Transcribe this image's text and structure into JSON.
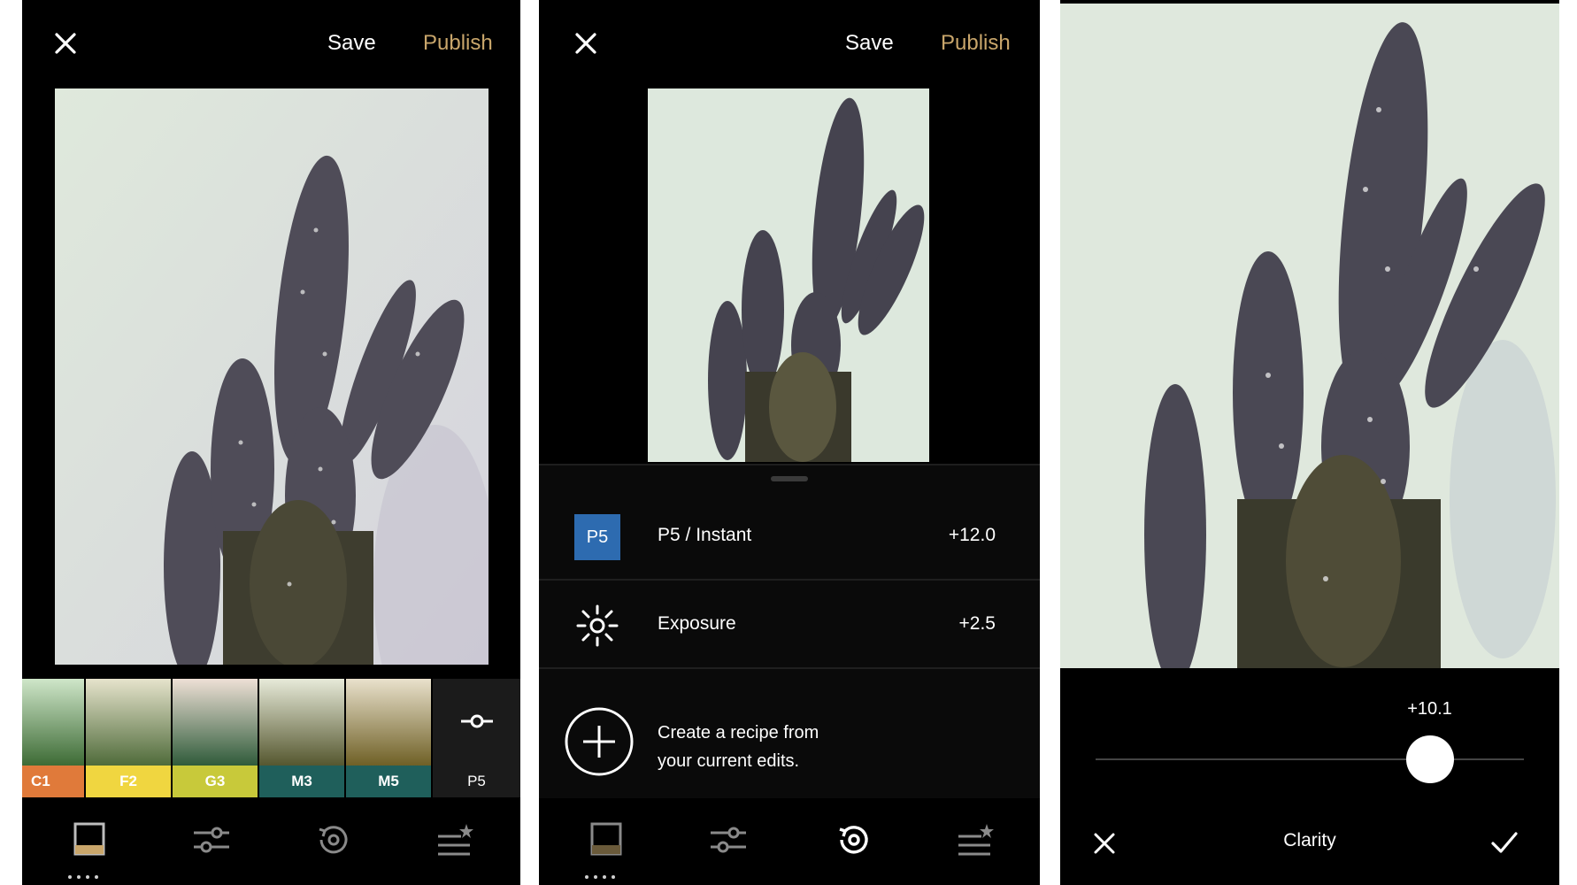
{
  "screen1": {
    "top": {
      "save_label": "Save",
      "publish_label": "Publish"
    },
    "filters": [
      {
        "label": "C1",
        "color": "#e07a3a"
      },
      {
        "label": "F2",
        "color": "#f0d640"
      },
      {
        "label": "G3",
        "color": "#c8c93a"
      },
      {
        "label": "M3",
        "color": "#1f5f5b"
      },
      {
        "label": "M5",
        "color": "#1f5f5b"
      }
    ],
    "selected_filter": "P5",
    "nav": [
      "presets-icon",
      "adjust-icon",
      "history-icon",
      "recipes-icon"
    ]
  },
  "screen2": {
    "top": {
      "save_label": "Save",
      "publish_label": "Publish"
    },
    "edits": [
      {
        "badge": "P5",
        "label": "P5 / Instant",
        "value": "+12.0"
      },
      {
        "label": "Exposure",
        "value": "+2.5"
      }
    ],
    "recipe_line1": "Create a recipe from",
    "recipe_line2": "your current edits."
  },
  "screen3": {
    "slider_value": "+10.1",
    "slider_level": 0.78,
    "tool_label": "Clarity"
  },
  "colors": {
    "accent_gold": "#c9a66b",
    "badge_blue": "#2d6bb0"
  }
}
